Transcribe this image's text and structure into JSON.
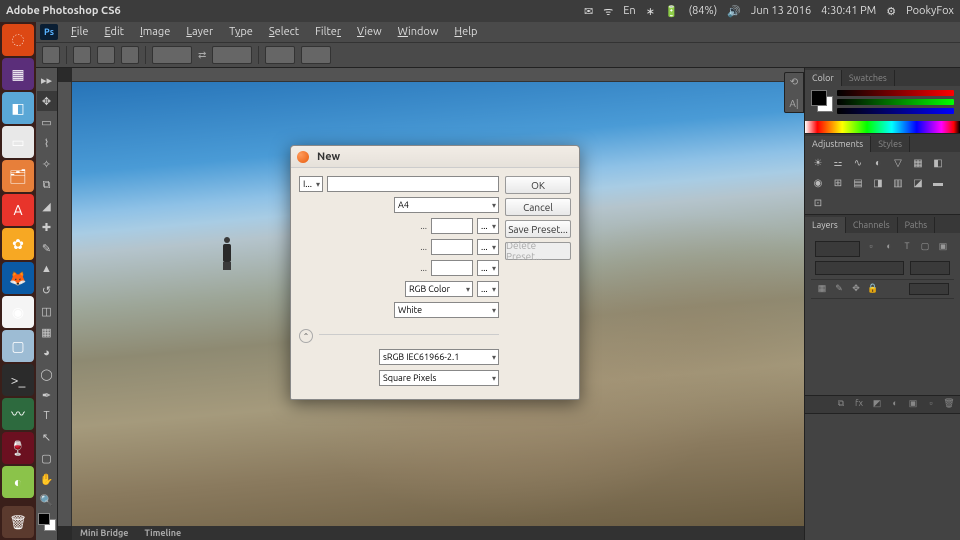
{
  "ubuntu": {
    "window_title": "Adobe Photoshop CS6",
    "lang": "En",
    "battery": "(84%)",
    "date": "Jun 13 2016",
    "time": "4:30:41 PM",
    "user": "PookyFox"
  },
  "menus": [
    "File",
    "Edit",
    "Image",
    "Layer",
    "Type",
    "Select",
    "Filter",
    "View",
    "Window",
    "Help"
  ],
  "bottom_tabs": [
    "Mini Bridge",
    "Timeline"
  ],
  "panels": {
    "color": {
      "tabs": [
        "Color",
        "Swatches"
      ]
    },
    "adjustments": {
      "tabs": [
        "Adjustments",
        "Styles"
      ]
    },
    "layers": {
      "tabs": [
        "Layers",
        "Channels",
        "Paths"
      ]
    }
  },
  "collapsed": [
    "⟲",
    "A|"
  ],
  "dialog": {
    "title": "New",
    "name_label": "I...",
    "preset": "A4",
    "color_mode": "RGB Color",
    "background": "White",
    "profile": "sRGB IEC61966-2.1",
    "pixel_aspect": "Square Pixels",
    "buttons": {
      "ok": "OK",
      "cancel": "Cancel",
      "save_preset": "Save Preset...",
      "delete_preset": "Delete Preset..."
    }
  }
}
